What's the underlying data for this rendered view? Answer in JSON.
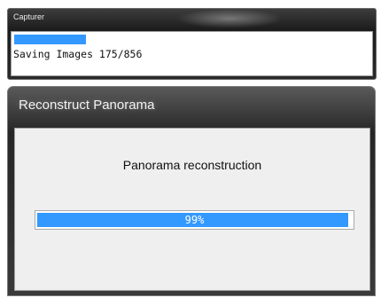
{
  "capturer": {
    "title": "Capturer",
    "progress": 0.204,
    "status": "Saving Images 175/856"
  },
  "reconstruct": {
    "title": "Reconstruct Panorama",
    "heading": "Panorama reconstruction",
    "progress": 0.99,
    "percent_label": "99%"
  },
  "colors": {
    "progress_fill": "#3399ff",
    "dialog_background": "#efefef"
  }
}
